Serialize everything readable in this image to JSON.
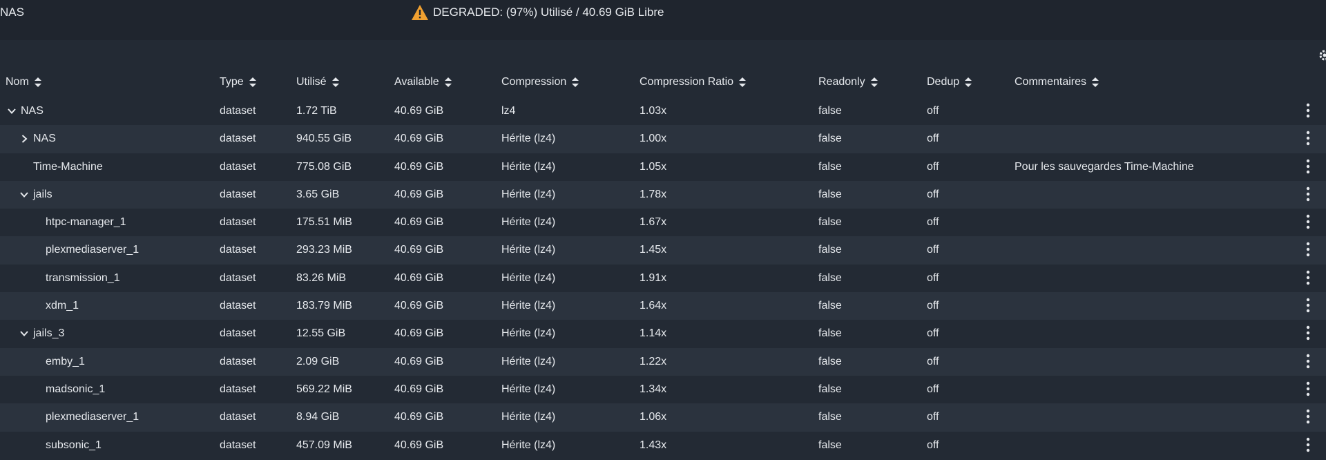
{
  "pool": {
    "name": "NAS",
    "status_text": "DEGRADED: (97%) Utilisé / 40.69 GiB Libre"
  },
  "columns": [
    {
      "key": "name",
      "label": "Nom"
    },
    {
      "key": "type",
      "label": "Type"
    },
    {
      "key": "used",
      "label": "Utilisé"
    },
    {
      "key": "available",
      "label": "Available"
    },
    {
      "key": "compression",
      "label": "Compression"
    },
    {
      "key": "ratio",
      "label": "Compression Ratio"
    },
    {
      "key": "readonly",
      "label": "Readonly"
    },
    {
      "key": "dedup",
      "label": "Dedup"
    },
    {
      "key": "comments",
      "label": "Commentaires"
    }
  ],
  "rows": [
    {
      "name": "NAS",
      "depth": 0,
      "toggle": "expanded",
      "type": "dataset",
      "used": "1.72 TiB",
      "available": "40.69 GiB",
      "compression": "lz4",
      "ratio": "1.03x",
      "readonly": "false",
      "dedup": "off",
      "comments": ""
    },
    {
      "name": "NAS",
      "depth": 1,
      "toggle": "collapsed",
      "type": "dataset",
      "used": "940.55 GiB",
      "available": "40.69 GiB",
      "compression": "Hérite (lz4)",
      "ratio": "1.00x",
      "readonly": "false",
      "dedup": "off",
      "comments": ""
    },
    {
      "name": "Time-Machine",
      "depth": 1,
      "toggle": "none",
      "type": "dataset",
      "used": "775.08 GiB",
      "available": "40.69 GiB",
      "compression": "Hérite (lz4)",
      "ratio": "1.05x",
      "readonly": "false",
      "dedup": "off",
      "comments": "Pour les sauvegardes Time-Machine"
    },
    {
      "name": "jails",
      "depth": 1,
      "toggle": "expanded",
      "type": "dataset",
      "used": "3.65 GiB",
      "available": "40.69 GiB",
      "compression": "Hérite (lz4)",
      "ratio": "1.78x",
      "readonly": "false",
      "dedup": "off",
      "comments": ""
    },
    {
      "name": "htpc-manager_1",
      "depth": 2,
      "toggle": "none",
      "type": "dataset",
      "used": "175.51 MiB",
      "available": "40.69 GiB",
      "compression": "Hérite (lz4)",
      "ratio": "1.67x",
      "readonly": "false",
      "dedup": "off",
      "comments": ""
    },
    {
      "name": "plexmediaserver_1",
      "depth": 2,
      "toggle": "none",
      "type": "dataset",
      "used": "293.23 MiB",
      "available": "40.69 GiB",
      "compression": "Hérite (lz4)",
      "ratio": "1.45x",
      "readonly": "false",
      "dedup": "off",
      "comments": ""
    },
    {
      "name": "transmission_1",
      "depth": 2,
      "toggle": "none",
      "type": "dataset",
      "used": "83.26 MiB",
      "available": "40.69 GiB",
      "compression": "Hérite (lz4)",
      "ratio": "1.91x",
      "readonly": "false",
      "dedup": "off",
      "comments": ""
    },
    {
      "name": "xdm_1",
      "depth": 2,
      "toggle": "none",
      "type": "dataset",
      "used": "183.79 MiB",
      "available": "40.69 GiB",
      "compression": "Hérite (lz4)",
      "ratio": "1.64x",
      "readonly": "false",
      "dedup": "off",
      "comments": ""
    },
    {
      "name": "jails_3",
      "depth": 1,
      "toggle": "expanded",
      "type": "dataset",
      "used": "12.55 GiB",
      "available": "40.69 GiB",
      "compression": "Hérite (lz4)",
      "ratio": "1.14x",
      "readonly": "false",
      "dedup": "off",
      "comments": ""
    },
    {
      "name": "emby_1",
      "depth": 2,
      "toggle": "none",
      "type": "dataset",
      "used": "2.09 GiB",
      "available": "40.69 GiB",
      "compression": "Hérite (lz4)",
      "ratio": "1.22x",
      "readonly": "false",
      "dedup": "off",
      "comments": ""
    },
    {
      "name": "madsonic_1",
      "depth": 2,
      "toggle": "none",
      "type": "dataset",
      "used": "569.22 MiB",
      "available": "40.69 GiB",
      "compression": "Hérite (lz4)",
      "ratio": "1.34x",
      "readonly": "false",
      "dedup": "off",
      "comments": ""
    },
    {
      "name": "plexmediaserver_1",
      "depth": 2,
      "toggle": "none",
      "type": "dataset",
      "used": "8.94 GiB",
      "available": "40.69 GiB",
      "compression": "Hérite (lz4)",
      "ratio": "1.06x",
      "readonly": "false",
      "dedup": "off",
      "comments": ""
    },
    {
      "name": "subsonic_1",
      "depth": 2,
      "toggle": "none",
      "type": "dataset",
      "used": "457.09 MiB",
      "available": "40.69 GiB",
      "compression": "Hérite (lz4)",
      "ratio": "1.43x",
      "readonly": "false",
      "dedup": "off",
      "comments": ""
    }
  ],
  "icons": {
    "warning": "warning-triangle-icon",
    "sort": "sort-icon",
    "expand": "chevron-down-icon",
    "collapse": "chevron-right-icon",
    "menu": "more-vertical-icon",
    "settings": "gear-icon"
  },
  "colors": {
    "background": "#232a34",
    "row_alt": "#2b333e",
    "header": "#1f252e",
    "warning": "#f0a030",
    "text": "#e6e9ed"
  }
}
